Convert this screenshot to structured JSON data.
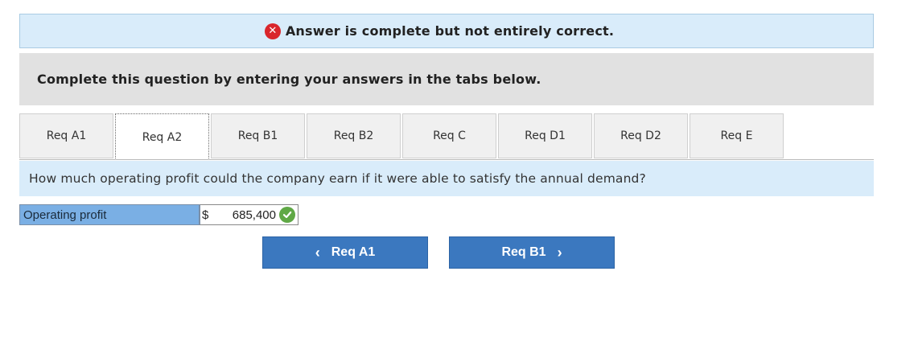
{
  "banner": {
    "icon": "error-x-icon",
    "text": "Answer is complete but not entirely correct."
  },
  "instructions": {
    "text": "Complete this question by entering your answers in the tabs below."
  },
  "tabs": [
    {
      "label": "Req A1"
    },
    {
      "label": "Req A2",
      "active": true
    },
    {
      "label": "Req B1"
    },
    {
      "label": "Req B2"
    },
    {
      "label": "Req C"
    },
    {
      "label": "Req D1"
    },
    {
      "label": "Req D2"
    },
    {
      "label": "Req E"
    }
  ],
  "question": {
    "text": "How much operating profit could the company earn if it were able to satisfy the annual demand?"
  },
  "answer": {
    "label": "Operating profit",
    "currency": "$",
    "value": "685,400",
    "status_icon": "check-icon"
  },
  "nav": {
    "prev_label": "Req A1",
    "next_label": "Req B1"
  },
  "colors": {
    "banner_bg": "#d9ecfa",
    "error_red": "#d9262c",
    "correct_green": "#5fa845",
    "button_blue": "#3b78bf",
    "label_blue": "#7aafe4"
  }
}
